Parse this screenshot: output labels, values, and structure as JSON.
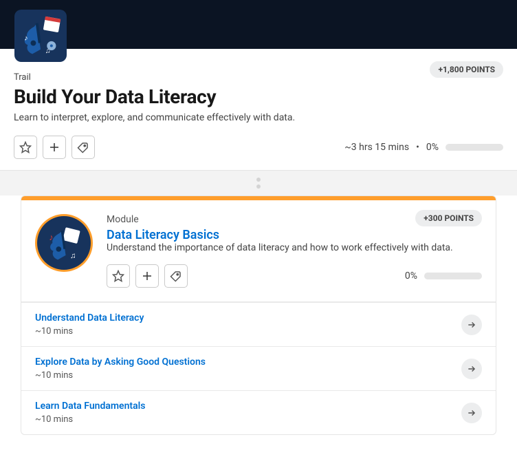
{
  "trail": {
    "kicker": "Trail",
    "title": "Build Your Data Literacy",
    "subtitle": "Learn to interpret, explore, and communicate effectively with data.",
    "points_label": "+1,800 POINTS",
    "duration": "~3 hrs 15 mins",
    "separator": "•",
    "progress": "0%"
  },
  "module": {
    "kicker": "Module",
    "title": "Data Literacy Basics",
    "subtitle": "Understand the importance of data literacy and how to work effectively with data.",
    "points_label": "+300 POINTS",
    "progress": "0%",
    "units": [
      {
        "title": "Understand Data Literacy",
        "time": "~10 mins"
      },
      {
        "title": "Explore Data by Asking Good Questions",
        "time": "~10 mins"
      },
      {
        "title": "Learn Data Fundamentals",
        "time": "~10 mins"
      }
    ]
  }
}
